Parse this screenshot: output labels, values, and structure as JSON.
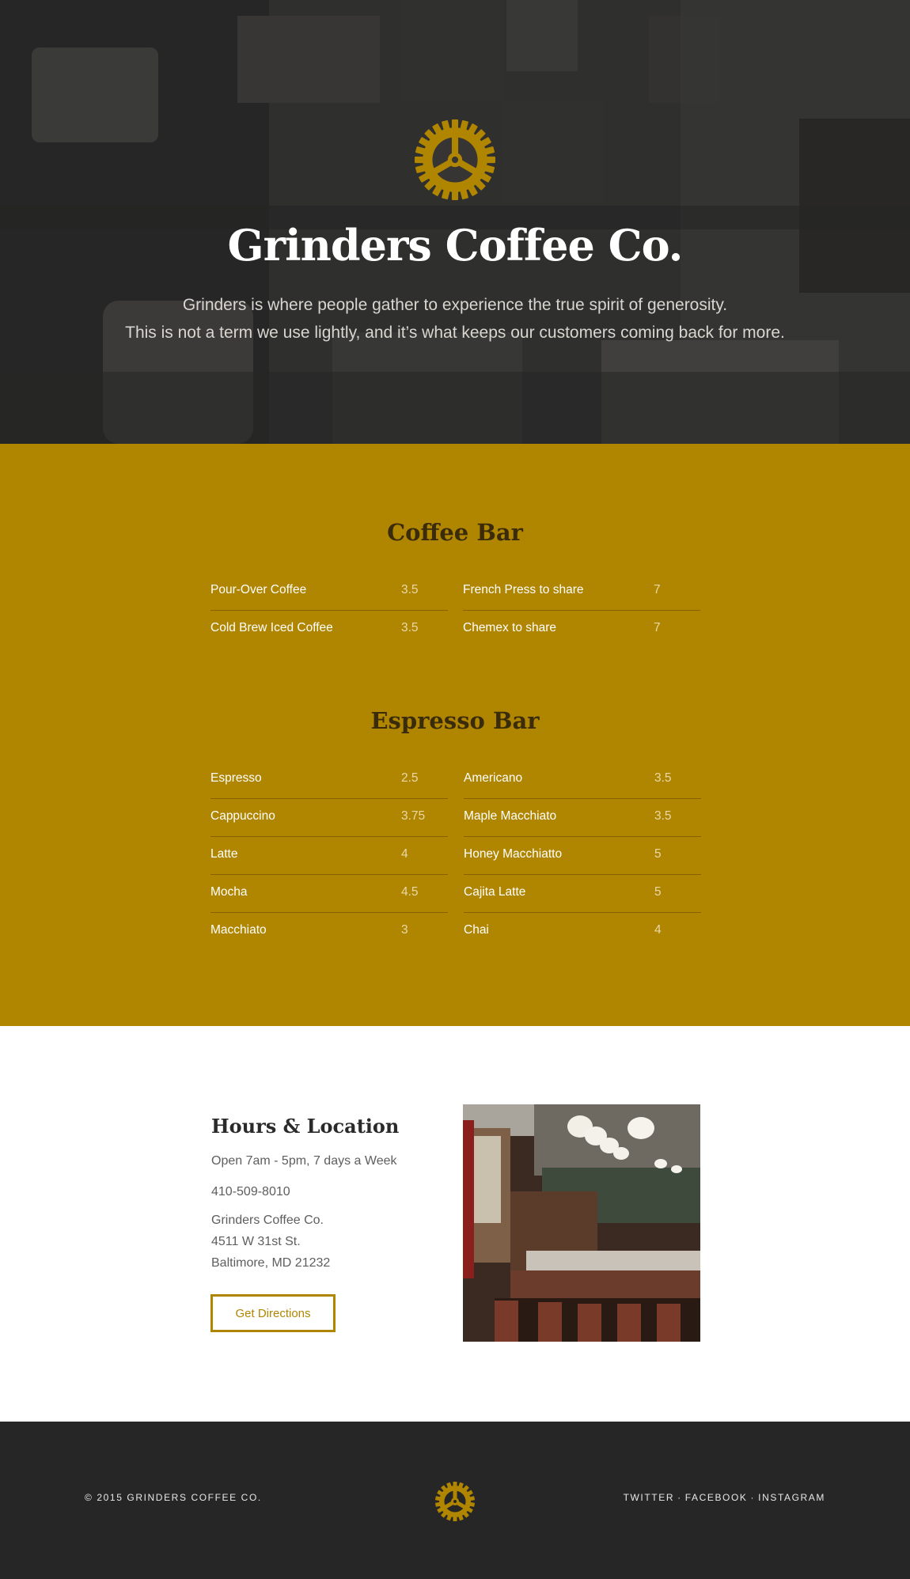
{
  "colors": {
    "accent": "#b08500",
    "footer_bg": "#262626",
    "menu_text": "#ffffff"
  },
  "hero": {
    "title": "Grinders Coffee Co.",
    "description_line1": "Grinders is where people gather to experience the true spirit of generosity.",
    "description_line2": "This is not a term we use lightly, and it’s what keeps our customers coming back for more.",
    "logo_icon": "gear-icon"
  },
  "menu": {
    "coffee_bar": {
      "heading": "Coffee Bar",
      "left": [
        {
          "name": "Pour-Over Coffee",
          "price": "3.5"
        },
        {
          "name": "Cold Brew Iced Coffee",
          "price": "3.5"
        }
      ],
      "right": [
        {
          "name": "French Press to share",
          "price": "7"
        },
        {
          "name": "Chemex to share",
          "price": "7"
        }
      ]
    },
    "espresso_bar": {
      "heading": "Espresso Bar",
      "left": [
        {
          "name": "Espresso",
          "price": "2.5"
        },
        {
          "name": "Cappuccino",
          "price": "3.75"
        },
        {
          "name": "Latte",
          "price": "4"
        },
        {
          "name": "Mocha",
          "price": "4.5"
        },
        {
          "name": "Macchiato",
          "price": "3"
        }
      ],
      "right": [
        {
          "name": "Americano",
          "price": "3.5"
        },
        {
          "name": "Maple Macchiato",
          "price": "3.5"
        },
        {
          "name": "Honey Macchiatto",
          "price": "5"
        },
        {
          "name": "Cajita Latte",
          "price": "5"
        },
        {
          "name": "Chai",
          "price": "4"
        }
      ]
    }
  },
  "hours": {
    "title": "Hours & Location",
    "open": "Open 7am - 5pm, 7 days a Week",
    "phone": "410-509-8010",
    "address": [
      "Grinders Coffee Co.",
      "4511 W 31st St.",
      "Baltimore, MD 21232"
    ],
    "directions_label": "Get Directions"
  },
  "footer": {
    "copyright": "© 2015 GRINDERS COFFEE CO.",
    "links": [
      "TWITTER",
      "FACEBOOK",
      "INSTAGRAM"
    ],
    "separator": "·",
    "logo_icon": "gear-icon"
  }
}
